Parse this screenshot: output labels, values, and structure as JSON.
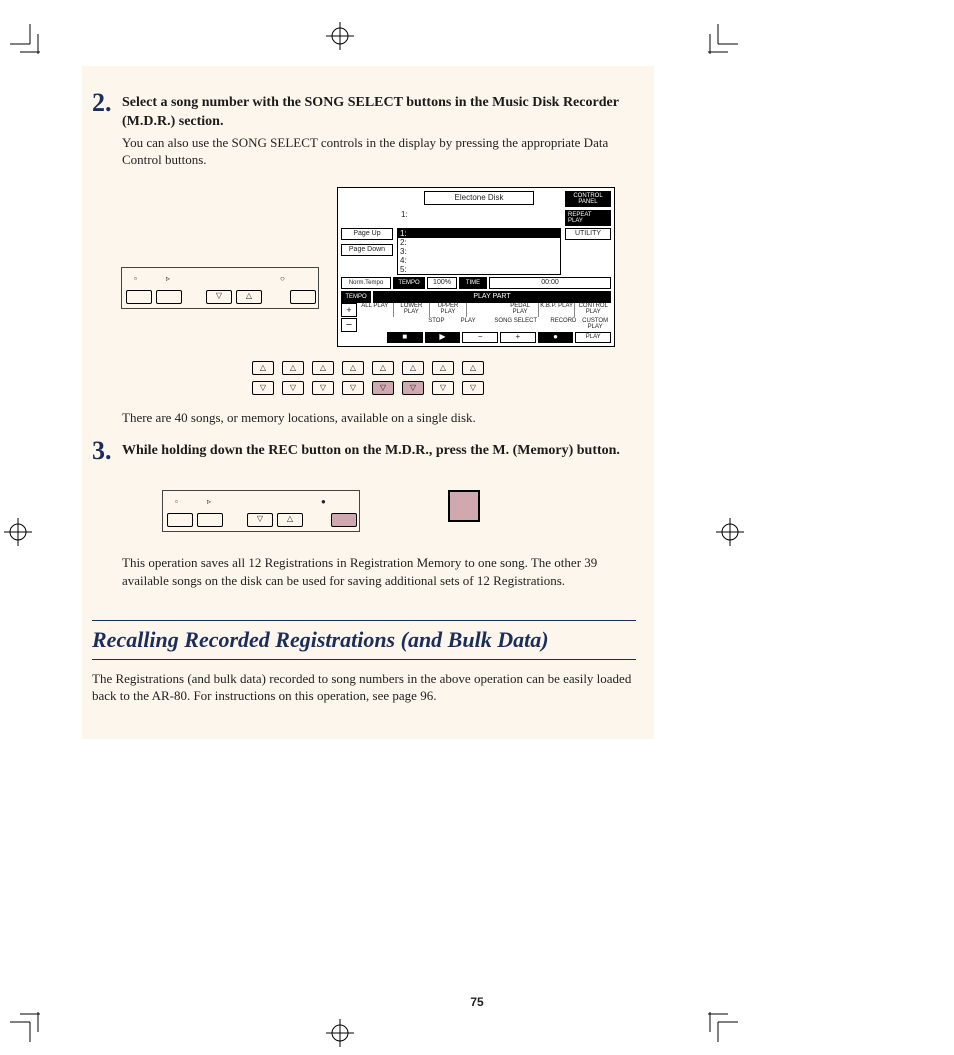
{
  "steps": {
    "s2": {
      "num": "2.",
      "bold": "Select a song number with the SONG SELECT buttons in the Music Disk Recorder (M.D.R.) section.",
      "sub": "You can also use the SONG SELECT controls in the display by pressing the appropriate Data Control buttons."
    },
    "s2_note": "There are 40 songs, or memory locations, available on a single disk.",
    "s3": {
      "num": "3.",
      "bold": "While holding down the REC button on the M.D.R., press the M. (Memory) button."
    },
    "s3_note": "This operation saves all 12 Registrations in Registration Memory to one song.  The other 39 available songs on the disk can be used for saving additional sets of 12 Registrations."
  },
  "lcd": {
    "title": "Electone Disk",
    "right_btns": [
      "CONTROL PANEL",
      "REPEAT PLAY",
      "UTILITY"
    ],
    "left_btns": [
      "Page Up",
      "Page Down",
      "Norm.Tempo"
    ],
    "list_header": "1:",
    "list": [
      "1:",
      "2:",
      "3:",
      "4:",
      "5:"
    ],
    "status": {
      "tempo_lbl": "TEMPO",
      "tempo_val": "100%",
      "time_lbl": "TIME",
      "time_val": "00:00"
    },
    "tempo_side": "TEMPO",
    "play_part": "PLAY PART",
    "parts_top": [
      "ALL PLAY",
      "LOWER PLAY",
      "UPPER PLAY",
      "",
      "PEDAL PLAY",
      "K.B.P. PLAY",
      "CONTROL PLAY"
    ],
    "bottom_labels": [
      "STOP",
      "PLAY",
      "SONG SELECT",
      "RECORD",
      "CUSTOM PLAY"
    ],
    "bottom_btns": [
      "■",
      "▶",
      "−",
      "+",
      "●",
      "PLAY"
    ]
  },
  "section": {
    "title": "Recalling Recorded Registrations (and Bulk Data)",
    "body": "The Registrations (and bulk data) recorded to song numbers in the above operation can be easily loaded back to the AR-80.  For instructions on this operation, see page 96."
  },
  "page_number": "75",
  "glyphs": {
    "up": "△",
    "down": "▽",
    "stop": "▫",
    "play": "▹",
    "rec": "○",
    "rec_solid": "●"
  }
}
